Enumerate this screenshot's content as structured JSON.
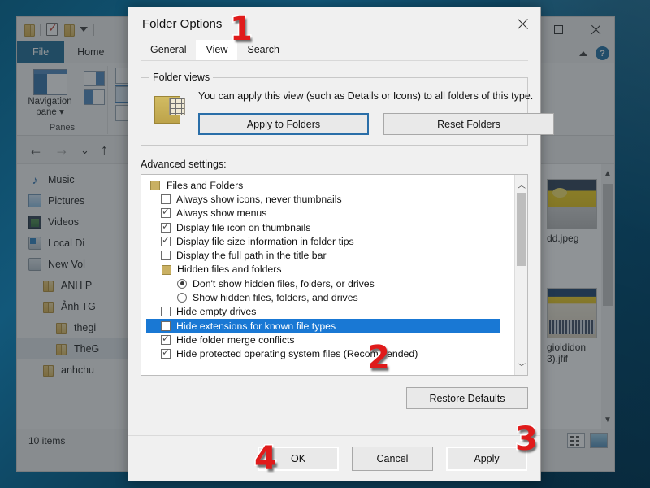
{
  "explorer": {
    "window_title": "",
    "quick_access_icons": [
      "folder-icon",
      "properties-icon",
      "new-folder-icon",
      "customize-caret-icon"
    ],
    "window_buttons": {
      "maximize": "maximize-icon",
      "close": "close-icon"
    },
    "ribbon": {
      "tabs": [
        {
          "label": "File",
          "active": true
        },
        {
          "label": "Home",
          "active": false
        }
      ],
      "collapse_icon": "chevron-up-icon",
      "help_label": "?",
      "groups": [
        {
          "name": "Panes",
          "main_button_label": "Navigation\npane",
          "main_button_line1": "Navigation",
          "main_button_line2": "pane",
          "group_label": "Panes"
        }
      ]
    },
    "navbar": {
      "back": "←",
      "forward": "→",
      "recent": "⌄",
      "up": "↑"
    },
    "sidebar": {
      "items": [
        {
          "label": "Music",
          "icon": "music-icon",
          "indent": 0,
          "selected": false
        },
        {
          "label": "Pictures",
          "icon": "pictures-icon",
          "indent": 0,
          "selected": false
        },
        {
          "label": "Videos",
          "icon": "videos-icon",
          "indent": 0,
          "selected": false
        },
        {
          "label": "Local Di",
          "icon": "drive-windows-icon",
          "indent": 0,
          "selected": false
        },
        {
          "label": "New Vol",
          "icon": "drive-icon",
          "indent": 0,
          "selected": false
        },
        {
          "label": "ANH P",
          "icon": "folder-icon",
          "indent": 1,
          "selected": false
        },
        {
          "label": "Ảnh TG",
          "icon": "folder-icon",
          "indent": 1,
          "selected": false
        },
        {
          "label": "thegi",
          "icon": "folder-icon",
          "indent": 2,
          "selected": false
        },
        {
          "label": "TheG",
          "icon": "folder-icon",
          "indent": 2,
          "selected": true
        },
        {
          "label": "anhchu",
          "icon": "folder-icon",
          "indent": 1,
          "selected": false
        }
      ]
    },
    "files": [
      {
        "name": "dd.jpeg",
        "thumb": "storefront-yellow"
      },
      {
        "name": "gioididon",
        "thumb": "group-photo"
      },
      {
        "name": "3).jfif",
        "thumb": ""
      }
    ],
    "file_labels": [
      "dd.jpeg",
      "gioididon",
      "3).jfif"
    ],
    "status": {
      "item_count": "10 items",
      "view_buttons": [
        "details-view-icon",
        "large-icons-view-icon"
      ]
    }
  },
  "dialog": {
    "title": "Folder Options",
    "close_label": "✕",
    "tabs": [
      {
        "label": "General",
        "active": false
      },
      {
        "label": "View",
        "active": true
      },
      {
        "label": "Search",
        "active": false
      }
    ],
    "folder_views": {
      "legend": "Folder views",
      "description": "You can apply this view (such as Details or Icons) to all folders of this type.",
      "apply_button": "Apply to Folders",
      "reset_button": "Reset Folders"
    },
    "advanced": {
      "label": "Advanced settings:",
      "rows": [
        {
          "label": "Files and Folders",
          "control": "group",
          "level": 0,
          "checked": false,
          "selected": false
        },
        {
          "label": "Always show icons, never thumbnails",
          "control": "checkbox",
          "level": 1,
          "checked": false,
          "selected": false
        },
        {
          "label": "Always show menus",
          "control": "checkbox",
          "level": 1,
          "checked": true,
          "selected": false
        },
        {
          "label": "Display file icon on thumbnails",
          "control": "checkbox",
          "level": 1,
          "checked": true,
          "selected": false
        },
        {
          "label": "Display file size information in folder tips",
          "control": "checkbox",
          "level": 1,
          "checked": true,
          "selected": false
        },
        {
          "label": "Display the full path in the title bar",
          "control": "checkbox",
          "level": 1,
          "checked": false,
          "selected": false
        },
        {
          "label": "Hidden files and folders",
          "control": "group",
          "level": 1,
          "checked": false,
          "selected": false
        },
        {
          "label": "Don't show hidden files, folders, or drives",
          "control": "radio",
          "level": 2,
          "checked": true,
          "selected": false
        },
        {
          "label": "Show hidden files, folders, and drives",
          "control": "radio",
          "level": 2,
          "checked": false,
          "selected": false
        },
        {
          "label": "Hide empty drives",
          "control": "checkbox",
          "level": 1,
          "checked": false,
          "selected": false
        },
        {
          "label": "Hide extensions for known file types",
          "control": "checkbox",
          "level": 1,
          "checked": false,
          "selected": true
        },
        {
          "label": "Hide folder merge conflicts",
          "control": "checkbox",
          "level": 1,
          "checked": true,
          "selected": false
        },
        {
          "label": "Hide protected operating system files (Recommended)",
          "control": "checkbox",
          "level": 1,
          "checked": true,
          "selected": false
        }
      ],
      "scroll_up_icon": "chevron-up-icon",
      "scroll_down_icon": "chevron-down-icon"
    },
    "restore_defaults_button": "Restore Defaults",
    "footer": {
      "ok": "OK",
      "cancel": "Cancel",
      "apply": "Apply"
    }
  },
  "annotations": [
    {
      "text": "1",
      "target": "view-tab"
    },
    {
      "text": "2",
      "target": "hide-extensions-row"
    },
    {
      "text": "3",
      "target": "apply-button"
    },
    {
      "text": "4",
      "target": "ok-button"
    }
  ],
  "annotation_labels": {
    "one": "1",
    "two": "2",
    "three": "3",
    "four": "4"
  },
  "colors": {
    "accent_blue": "#1978d4",
    "file_tab_blue": "#1a6a94",
    "annotation_red": "#e01b1b",
    "desktop_blue": "#12587a"
  }
}
